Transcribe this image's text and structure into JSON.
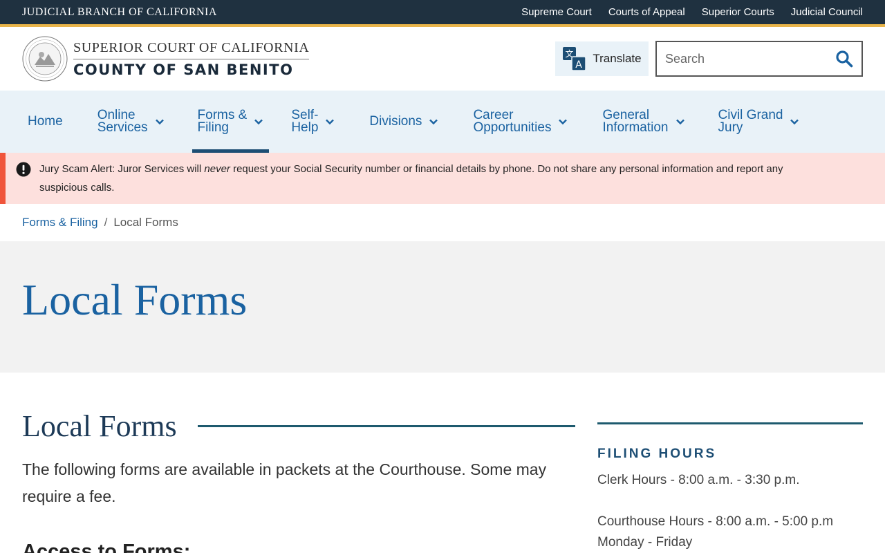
{
  "topbar": {
    "brand": "JUDICIAL BRANCH OF CALIFORNIA",
    "links": [
      "Supreme Court",
      "Courts of Appeal",
      "Superior Courts",
      "Judicial Council"
    ]
  },
  "header": {
    "logo_line1": "SUPERIOR COURT OF CALIFORNIA",
    "logo_line2": "COUNTY OF SAN BENITO",
    "seal_text": "JUDICIAL BRANCH OF CALIFORNIA",
    "translate_label": "Translate",
    "search_placeholder": "Search"
  },
  "nav": {
    "items": [
      {
        "line1": "Home",
        "line2": "",
        "has_dropdown": false,
        "active": false
      },
      {
        "line1": "Online",
        "line2": "Services",
        "has_dropdown": true,
        "active": false
      },
      {
        "line1": "Forms &",
        "line2": "Filing",
        "has_dropdown": true,
        "active": true
      },
      {
        "line1": "Self-",
        "line2": "Help",
        "has_dropdown": true,
        "active": false
      },
      {
        "line1": "Divisions",
        "line2": "",
        "has_dropdown": true,
        "active": false
      },
      {
        "line1": "Career",
        "line2": "Opportunities",
        "has_dropdown": true,
        "active": false
      },
      {
        "line1": "General",
        "line2": "Information",
        "has_dropdown": true,
        "active": false
      },
      {
        "line1": "Civil Grand",
        "line2": "Jury",
        "has_dropdown": true,
        "active": false
      }
    ]
  },
  "alert": {
    "part1": "Jury Scam Alert: Juror Services will ",
    "emphasis": "never",
    "part2": " request your Social Security number or financial details by phone. Do not share any personal information and report any suspicious calls."
  },
  "breadcrumb": {
    "parent": "Forms & Filing",
    "separator": "/",
    "current": "Local Forms"
  },
  "hero": {
    "title": "Local Forms"
  },
  "main": {
    "heading": "Local Forms",
    "intro": "The following forms are available in packets at the Courthouse. Some may require a fee.",
    "subheading": "Access to Forms:"
  },
  "sidebar": {
    "heading": "FILING HOURS",
    "clerk_hours": "Clerk Hours  - 8:00 a.m. - 3:30 p.m.",
    "courthouse_hours": "Courthouse Hours - 8:00 a.m. - 5:00 p.m",
    "days": "Monday - Friday"
  },
  "colors": {
    "topbar_bg": "#1f3140",
    "gold_accent": "#e8b44a",
    "link_blue": "#1a62a1",
    "nav_bg": "#e9f2f8",
    "alert_bg": "#fde0dd",
    "alert_border": "#f0543a",
    "heading_navy": "#1d3a57",
    "rule_teal": "#1e5a6e"
  },
  "icons": {
    "translate": "translate-icon",
    "search": "search-icon",
    "alert": "exclamation-circle-icon",
    "dropdown": "chevron-down-icon"
  }
}
